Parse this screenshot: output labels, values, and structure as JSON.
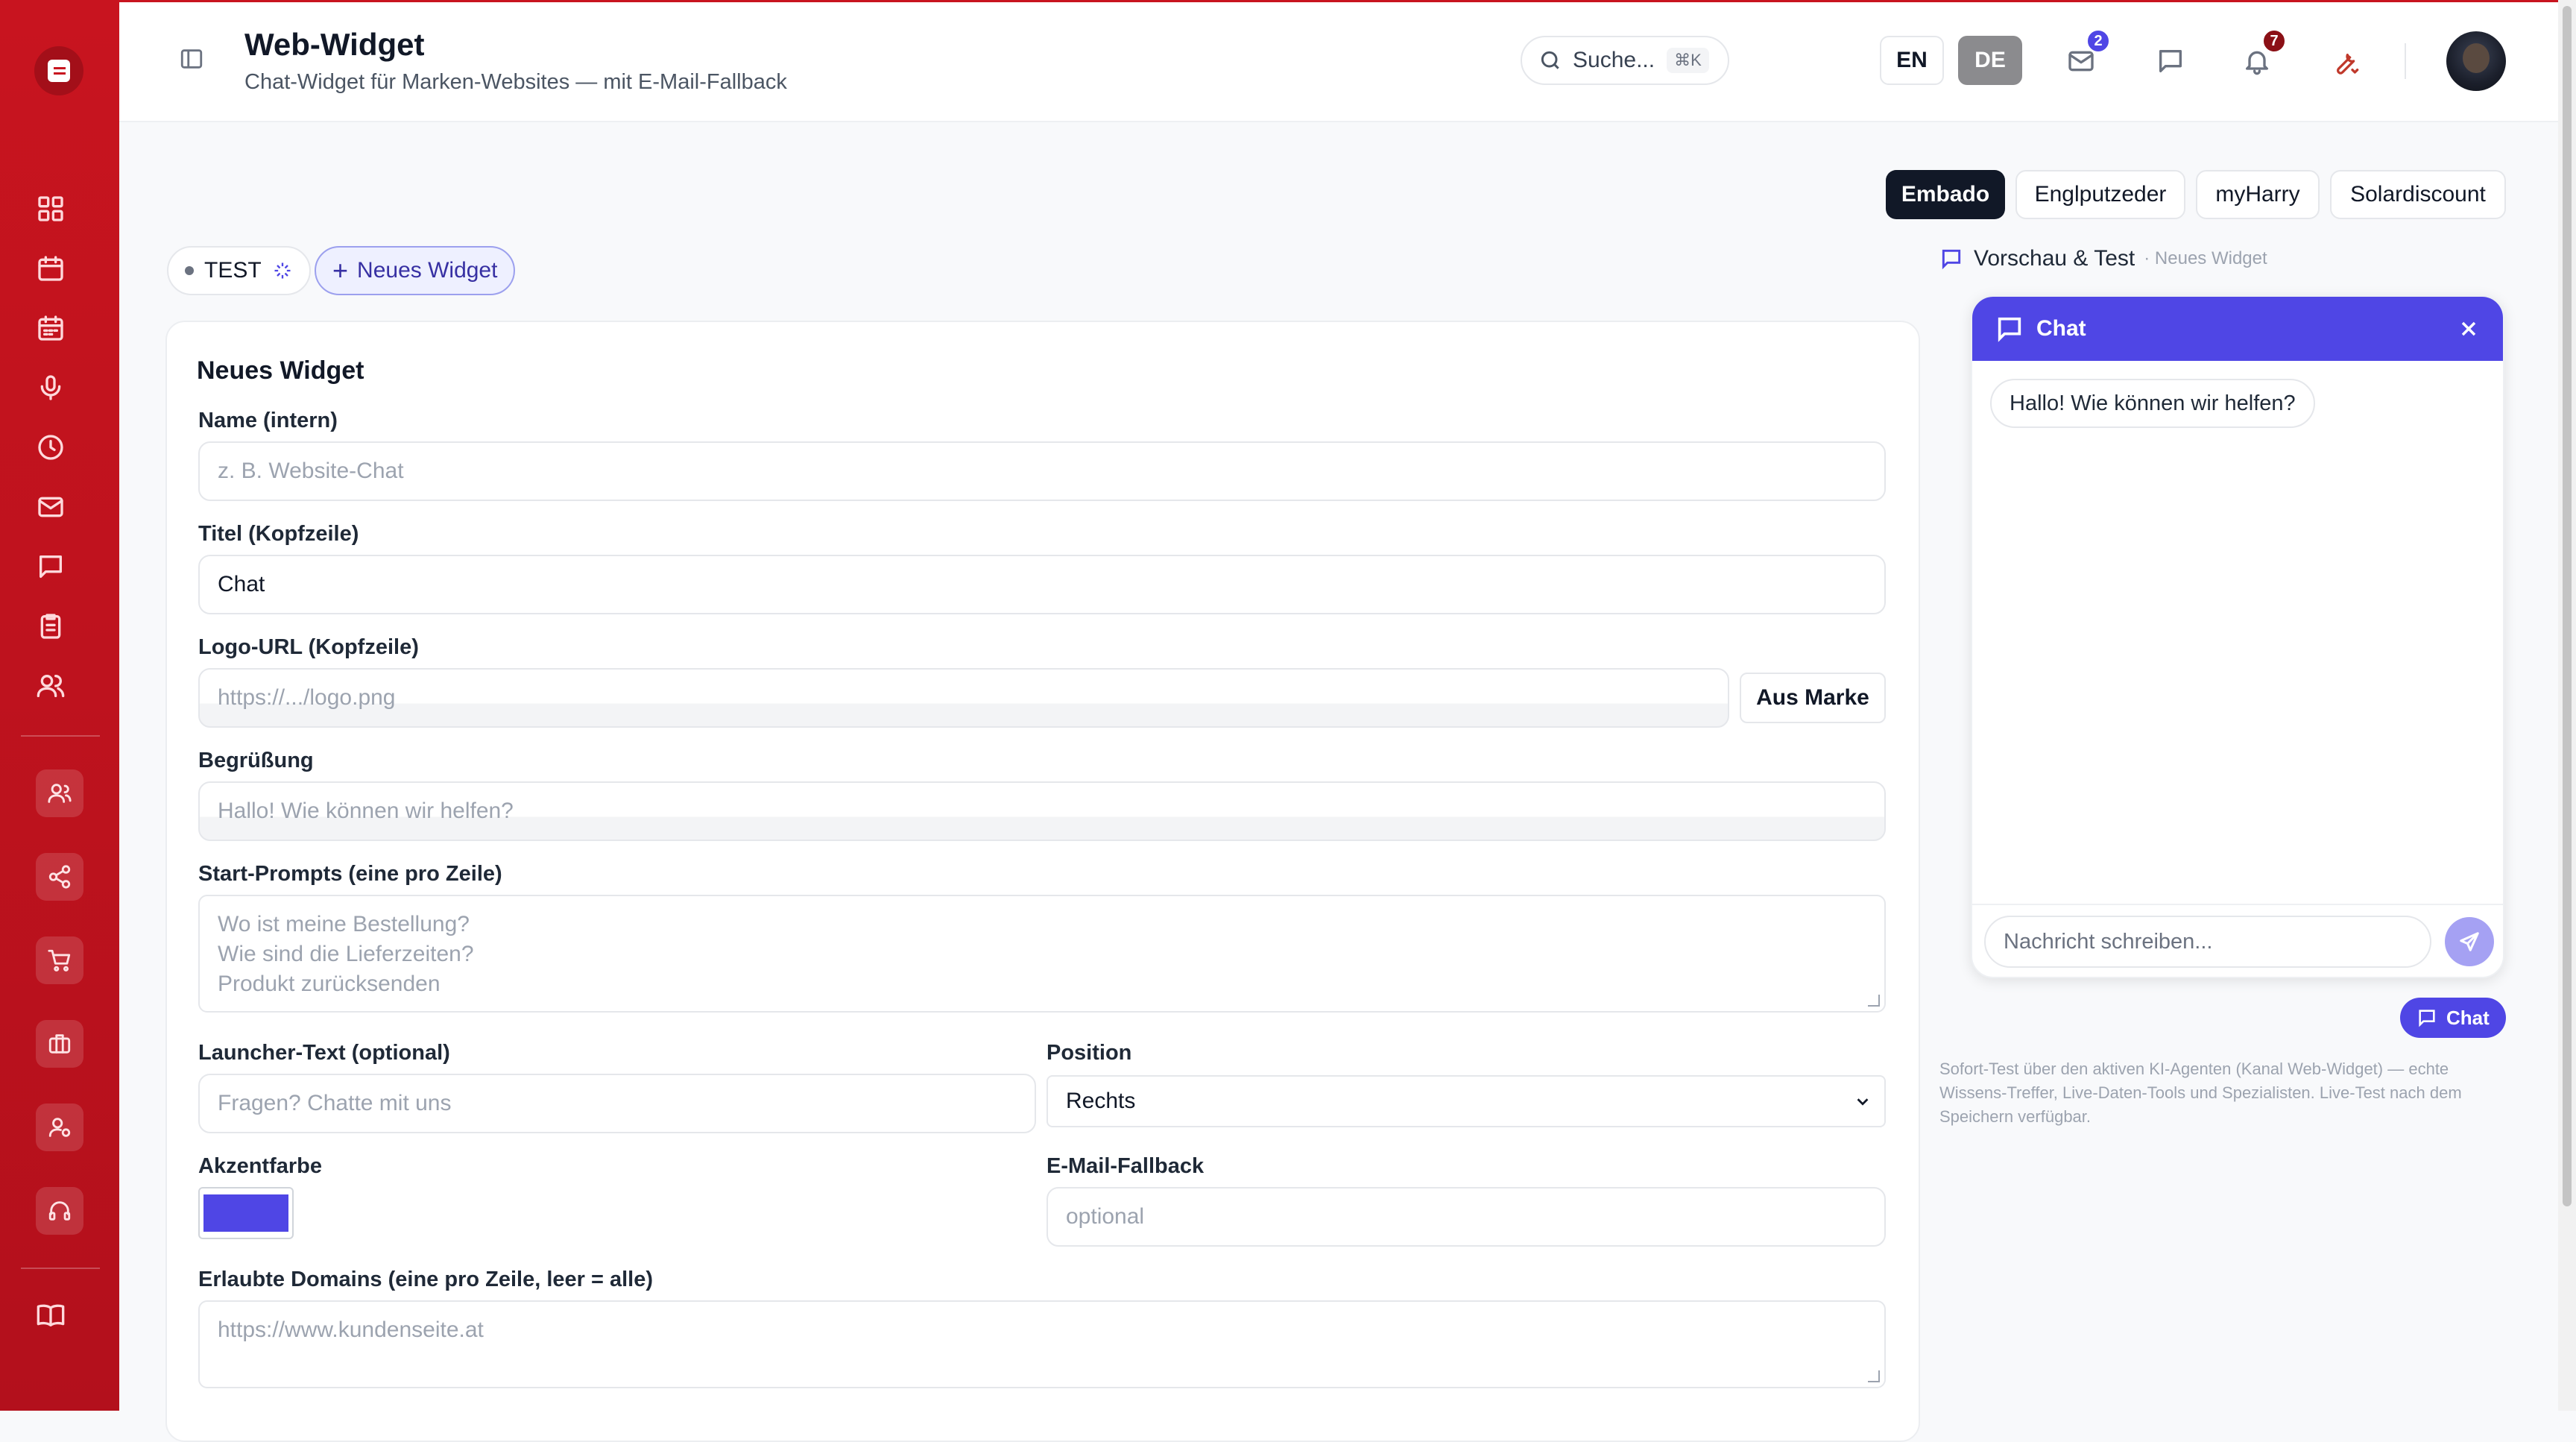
{
  "header": {
    "title": "Web-Widget",
    "subtitle": "Chat-Widget für Marken-Websites — mit E-Mail-Fallback",
    "search_placeholder": "Suche...",
    "search_shortcut": "⌘K",
    "lang_en": "EN",
    "lang_de": "DE",
    "mail_badge": "2",
    "notif_badge": "7"
  },
  "colors": {
    "sidebar": "#c8141f",
    "accent": "#4f46e5",
    "mail_badge": "#4f46e5",
    "notif_badge": "#8b1016"
  },
  "sidebar": {
    "icons": [
      "dashboard-icon",
      "calendar-icon",
      "calendar-grid-icon",
      "microphone-icon",
      "clock-icon",
      "mail-icon",
      "chat-icon",
      "clipboard-icon",
      "users-icon"
    ],
    "boxed_icons": [
      "contacts-icon",
      "share-icon",
      "cart-icon",
      "briefcase-icon",
      "user-settings-icon",
      "headset-icon"
    ],
    "bottom_icon": "book-icon"
  },
  "brands": [
    "Embado",
    "Englputzeder",
    "myHarry",
    "Solardiscount"
  ],
  "chips": {
    "test": "TEST",
    "new_widget": "Neues Widget"
  },
  "form": {
    "card_title": "Neues Widget",
    "name_label": "Name (intern)",
    "name_placeholder": "z. B. Website-Chat",
    "title_label": "Titel (Kopfzeile)",
    "title_value": "Chat",
    "logo_label": "Logo-URL (Kopfzeile)",
    "logo_placeholder": "https://.../logo.png",
    "logo_button": "Aus Marke",
    "greeting_label": "Begrüßung",
    "greeting_placeholder": "Hallo! Wie können wir helfen?",
    "prompts_label": "Start-Prompts (eine pro Zeile)",
    "prompts_placeholder": [
      "Wo ist meine Bestellung?",
      "Wie sind die Lieferzeiten?",
      "Produkt zurücksenden"
    ],
    "launcher_label": "Launcher-Text (optional)",
    "launcher_placeholder": "Fragen? Chatte mit uns",
    "position_label": "Position",
    "position_value": "Rechts",
    "accent_label": "Akzentfarbe",
    "accent_color": "#4f46e5",
    "email_label": "E-Mail-Fallback",
    "email_placeholder": "optional",
    "domains_label": "Erlaubte Domains (eine pro Zeile, leer = alle)",
    "domains_placeholder": "https://www.kundenseite.at"
  },
  "preview": {
    "heading": "Vorschau & Test",
    "subheading": "· Neues Widget",
    "chat_title": "Chat",
    "greeting_bubble": "Hallo! Wie können wir helfen?",
    "input_placeholder": "Nachricht schreiben...",
    "launcher_label": "Chat",
    "note": "Sofort-Test über den aktiven KI-Agenten (Kanal Web-Widget) — echte Wissens-Treffer, Live-Daten-Tools und Spezialisten. Live-Test nach dem Speichern verfügbar."
  }
}
